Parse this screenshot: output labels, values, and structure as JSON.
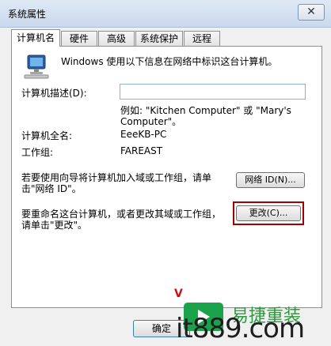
{
  "window": {
    "title": "系统属性",
    "close_glyph": "✕"
  },
  "tabs": [
    {
      "label": "计算机名",
      "active": true
    },
    {
      "label": "硬件",
      "active": false
    },
    {
      "label": "高级",
      "active": false
    },
    {
      "label": "系统保护",
      "active": false
    },
    {
      "label": "远程",
      "active": false
    }
  ],
  "intro": {
    "icon": "computer-icon",
    "text": "Windows 使用以下信息在网络中标识这台计算机。"
  },
  "description": {
    "label": "计算机描述(D):",
    "value": "",
    "example_line1": "例如: \"Kitchen Computer\" 或 \"Mary's",
    "example_line2": "Computer\"。"
  },
  "full_name": {
    "label": "计算机全名:",
    "value": "EeeKB-PC"
  },
  "workgroup": {
    "label": "工作组:",
    "value": "FAREAST"
  },
  "network_id": {
    "text_line1": "若要使用向导将计算机加入域或工作组，请单",
    "text_line2": "击\"网络 ID\"。",
    "button_label": "网络 ID(N)..."
  },
  "rename": {
    "text_line1": "要重命名这台计算机，或者更改其域或工作组，",
    "text_line2": "请单击\"更改\"。",
    "button_label": "更改(C)...",
    "highlight_color": "#a40000"
  },
  "footer": {
    "ok_label": "确定"
  },
  "watermark": {
    "red_mark": "V",
    "brand_cn": "易捷重装",
    "url": "it889.com"
  }
}
